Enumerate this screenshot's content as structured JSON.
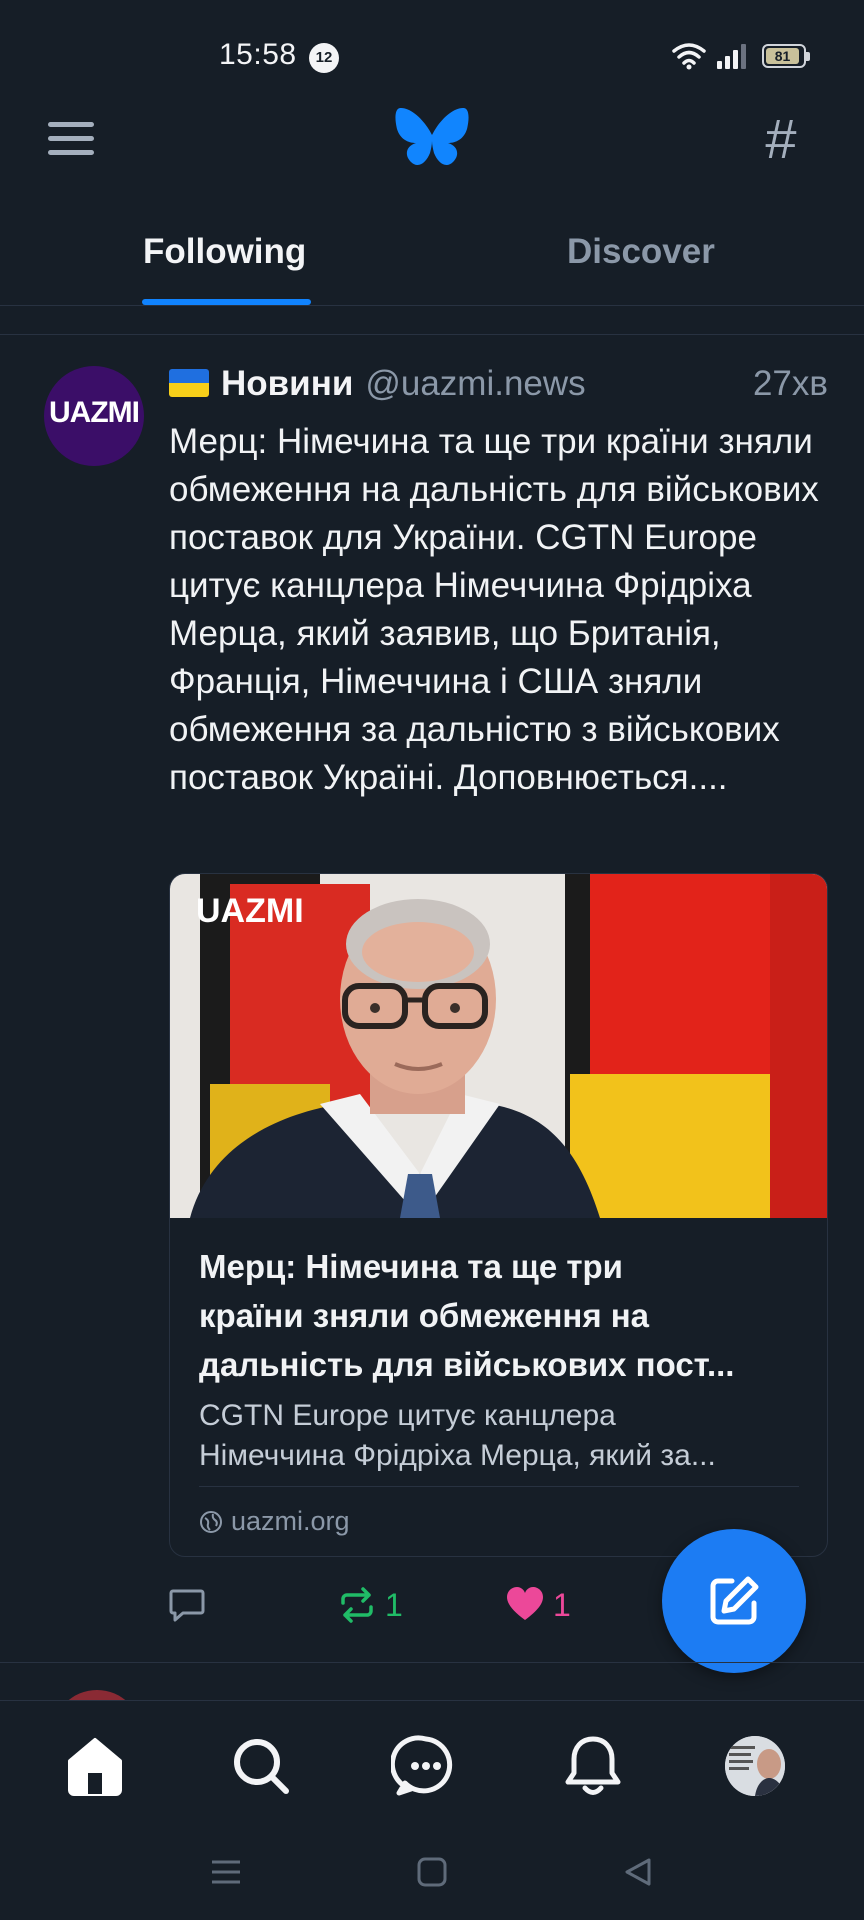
{
  "status_bar": {
    "time": "15:58",
    "notification_count": "12",
    "battery_level": "81"
  },
  "header": {
    "menu_icon": "hamburger-menu-icon",
    "logo_icon": "butterfly-logo-icon",
    "feeds_icon": "hashtag-icon",
    "accent_color": "#1083fe"
  },
  "tabs": [
    {
      "label": "Following",
      "active": true
    },
    {
      "label": "Discover",
      "active": false
    }
  ],
  "post": {
    "avatar_text": "UAZMI",
    "author_name": "Новини",
    "handle": "@uazmi.news",
    "time": "27хв",
    "text": "Мерц: Німечина та ще три країни зняли обмеження на дальність для військових поставок для України. CGTN Europe цитує канцлера Німеччина Фрідріха Мерца, який заявив, що Британія, Франція, Німеччина і США зняли обмеження за дальністю з військових поставок Україні. Доповнюється....",
    "card": {
      "image_logo": "UAZMI",
      "title": "Мерц: Німечина та ще три\nкраїни зняли обмеження на\nдальність для військових пост...",
      "description": "CGTN Europe цитує канцлера\nНімеччина Фрідріха Мерца, який за...",
      "domain": "uazmi.org"
    },
    "actions": {
      "reply_count": "",
      "repost_count": "1",
      "like_count": "1",
      "repost_color": "#20bc67",
      "like_color": "#ec4899"
    }
  },
  "fab": {
    "icon": "compose-icon"
  },
  "bottom_nav": [
    {
      "icon": "home-icon",
      "active": true
    },
    {
      "icon": "search-icon",
      "active": false
    },
    {
      "icon": "chat-icon",
      "active": false
    },
    {
      "icon": "bell-icon",
      "active": false
    },
    {
      "icon": "profile-avatar",
      "active": false
    }
  ],
  "system_nav": [
    "recents-icon",
    "home-square-icon",
    "back-icon"
  ]
}
